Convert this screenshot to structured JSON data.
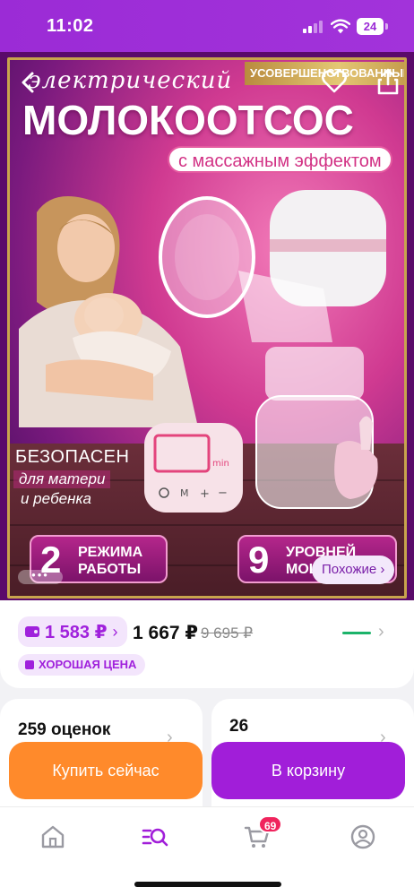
{
  "status_bar": {
    "time": "11:02",
    "battery": "24"
  },
  "product_image": {
    "headline_small": "электрический",
    "headline_big": "МОЛОКООТСОС",
    "ribbon": "УСОВЕРШЕНСТВОВАННЫЙ",
    "subtitle": "с массажным эффектом",
    "safe_line1": "БЕЗОПАСЕН",
    "safe_line2": "для матери",
    "safe_line3": "и ребенка",
    "modes_number": "2",
    "modes_line1": "РЕЖИМА",
    "modes_line2": "РАБОТЫ",
    "levels_number": "9",
    "levels_line1": "УРОВНЕЙ",
    "levels_line2": "МОЩ",
    "display_min": "min",
    "similar_button": "Похожие ›",
    "dots": "•••"
  },
  "price": {
    "wallet_price": "1 583 ₽",
    "wallet_chevron": "›",
    "main_price": "1 667 ₽",
    "old_price": "9 695 ₽",
    "good_price": "ХОРОШАЯ ЦЕНА",
    "chevron": "›"
  },
  "cards": {
    "reviews": "259 оценок",
    "questions": "26",
    "chevron": "›"
  },
  "actions": {
    "buy_now": "Купить сейчас",
    "add_to_cart": "В корзину"
  },
  "tab_bar": {
    "cart_badge": "69",
    "tabs": [
      "home-icon",
      "catalog-search-icon",
      "cart-icon",
      "profile-icon"
    ]
  },
  "colors": {
    "brand_purple": "#a11ed9",
    "buy_orange": "#ff8a2b",
    "badge_red": "#f0245d"
  }
}
